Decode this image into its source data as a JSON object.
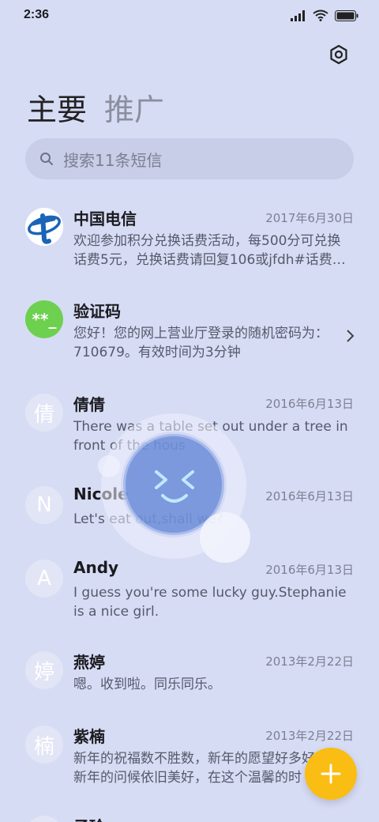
{
  "status": {
    "time": "2:36"
  },
  "tabs": [
    {
      "label": "主要"
    },
    {
      "label": "推广"
    }
  ],
  "search": {
    "placeholder": "搜索11条短信"
  },
  "messages": [
    {
      "name": "中国电信",
      "date": "2017年6月30日",
      "preview": "欢迎参加积分兑换话费活动，每500分可兑换话费5元，兑换话费请回复106或jfdh#话费…",
      "avatar": "telecom-logo"
    },
    {
      "name": "验证码",
      "date": "",
      "preview": "您好！您的网上营业厅登录的随机密码为：710679。有效时间为3分钟",
      "avatar": "**_"
    },
    {
      "name": "倩倩",
      "date": "2016年6月13日",
      "preview": "There was a table set out under a tree in front of the hous",
      "avatar": "倩"
    },
    {
      "name": "Nicole",
      "date": "2016年6月13日",
      "preview": "Let's eat out,shall we?",
      "avatar": "N"
    },
    {
      "name": "Andy",
      "date": "2016年6月13日",
      "preview": "I guess you're some lucky guy.Stephanie is a nice girl.",
      "avatar": "A"
    },
    {
      "name": "燕婷",
      "date": "2013年2月22日",
      "preview": "嗯。收到啦。同乐同乐。",
      "avatar": "婷"
    },
    {
      "name": "紫楠",
      "date": "2013年2月22日",
      "preview": "新年的祝福数不胜数，新年的愿望好多好多，新年的问候依旧美好，在这个温馨的时",
      "avatar": "楠"
    },
    {
      "name": "子玲",
      "date": "",
      "preview": "",
      "avatar": ""
    }
  ],
  "colors": {
    "background": "#d7dcf5",
    "fab": "#f9bd13",
    "verify_avatar": "#6dd14f",
    "telecom_blue": "#1b64b7"
  }
}
